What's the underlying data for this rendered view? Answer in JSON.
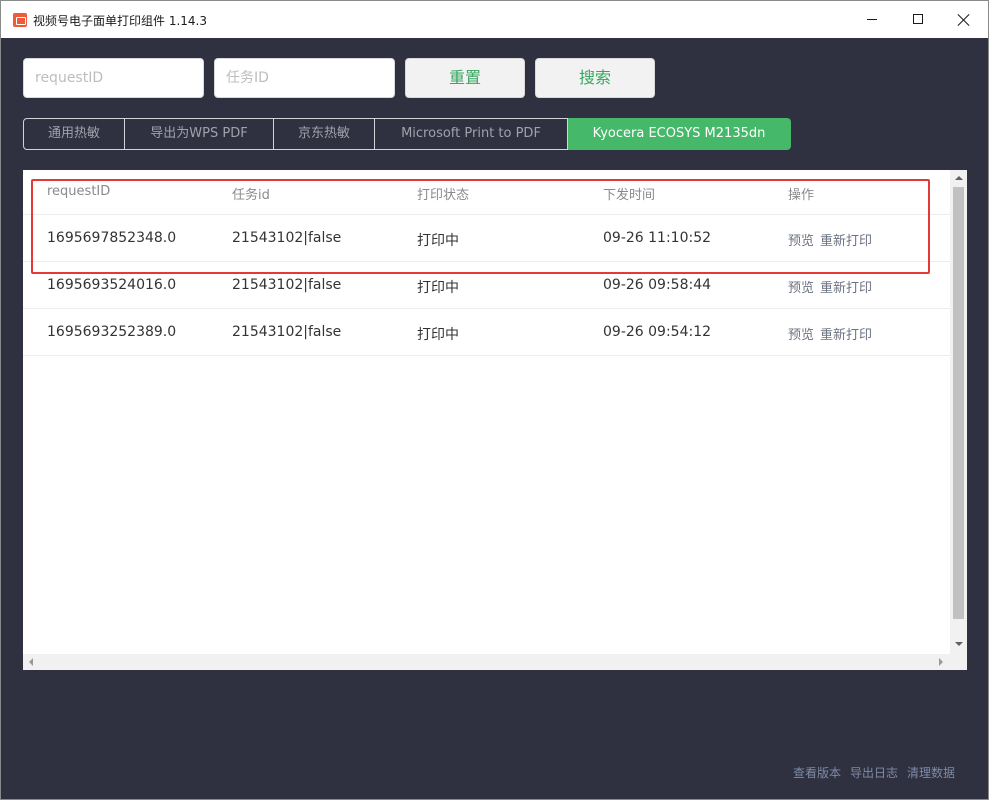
{
  "window": {
    "title": "视频号电子面单打印组件 1.14.3"
  },
  "search": {
    "request_placeholder": "requestID",
    "task_placeholder": "任务ID",
    "reset_label": "重置",
    "search_label": "搜索"
  },
  "tabs": [
    {
      "label": "通用热敏",
      "active": false
    },
    {
      "label": "导出为WPS PDF",
      "active": false
    },
    {
      "label": "京东热敏",
      "active": false
    },
    {
      "label": "Microsoft Print to PDF",
      "active": false
    },
    {
      "label": "Kyocera ECOSYS M2135dn",
      "active": true
    }
  ],
  "table": {
    "columns": [
      "requestID",
      "任务id",
      "打印状态",
      "下发时间",
      "操作"
    ],
    "rows": [
      {
        "request_id": "1695697852348.0",
        "task_id": "21543102|false",
        "status": "打印中",
        "time": "09-26 11:10:52",
        "actions": [
          "预览",
          "重新打印"
        ]
      },
      {
        "request_id": "1695693524016.0",
        "task_id": "21543102|false",
        "status": "打印中",
        "time": "09-26 09:58:44",
        "actions": [
          "预览",
          "重新打印"
        ]
      },
      {
        "request_id": "1695693252389.0",
        "task_id": "21543102|false",
        "status": "打印中",
        "time": "09-26 09:54:12",
        "actions": [
          "预览",
          "重新打印"
        ]
      }
    ]
  },
  "footer": {
    "links": [
      "查看版本",
      "导出日志",
      "清理数据"
    ]
  },
  "colors": {
    "background": "#2f3140",
    "accent": "#45b86a",
    "highlight": "#e53935"
  }
}
